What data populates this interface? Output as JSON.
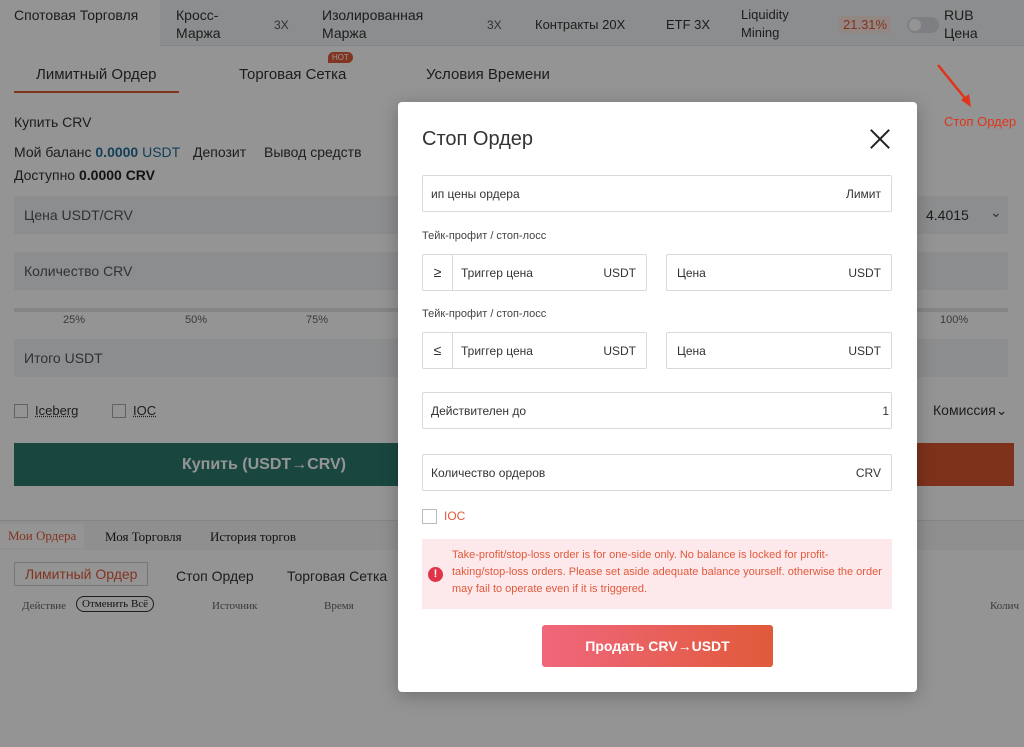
{
  "top_tabs": {
    "spot": "Спотовая Торговля",
    "cross": "Кросс-Маржа",
    "cross_lev": "3X",
    "isolated": "Изолированная Маржа",
    "isolated_lev": "3X",
    "contracts": "Контракты 20X",
    "etf": "ETF 3X",
    "liquidity": "Liquidity Mining",
    "liquidity_pct": "21.31%",
    "rub": "RUB Цена"
  },
  "order_tabs": {
    "limit": "Лимитный Ордер",
    "grid": "Торговая Сетка",
    "hot": "HOT",
    "time": "Условия Времени"
  },
  "form": {
    "buy_crv": "Купить CRV",
    "balance_label": "Мой баланс",
    "balance_value": "0.0000",
    "balance_unit": "USDT",
    "deposit": "Депозит",
    "withdraw": "Вывод средств",
    "available_label": "Доступно",
    "available_value": "0.0000 CRV",
    "price_label": "Цена USDT/CRV",
    "price_value": "4.4015",
    "qty_label": "Количество CRV",
    "pcts": [
      "25%",
      "50%",
      "75%",
      "100%"
    ],
    "total_label": "Итого USDT",
    "iceberg": "Iceberg",
    "ioc": "IOC",
    "commission": "Комиссия",
    "buy_button": "Купить (USDT→CRV)"
  },
  "bottom": {
    "tabs": [
      "Мои Ордера",
      "Моя Торговля",
      "История торгов"
    ],
    "subtabs": [
      "Лимитный Ордер",
      "Стоп Ордер",
      "Торговая Сетка"
    ],
    "col_action": "Действие",
    "cancel_all": "Отменить Всё",
    "col_source": "Источник",
    "col_time": "Время",
    "col_qty": "Колич"
  },
  "stop_link": "Стоп Ордер",
  "modal": {
    "title": "Стоп Ордер",
    "order_type_label": "ип цены ордера",
    "order_type_value": "Лимит",
    "tp_label_1": "Тейк-профит / стоп-лосс",
    "op_1": "≥",
    "trigger_label": "Триггер цена",
    "unit_usdt": "USDT",
    "price_label": "Цена",
    "tp_label_2": "Тейк-профит / стоп-лосс",
    "op_2": "≤",
    "valid_label": "Действителен до",
    "valid_value": "1",
    "count_label": "Количество ордеров",
    "count_unit": "CRV",
    "ioc": "IOC",
    "warning": "Take-profit/stop-loss order is for one-side only. No balance is locked for profit-taking/stop-loss orders. Please set aside adequate balance yourself. otherwise the order may fail to operate even if it is triggered.",
    "sell_button": "Продать CRV→USDT"
  }
}
